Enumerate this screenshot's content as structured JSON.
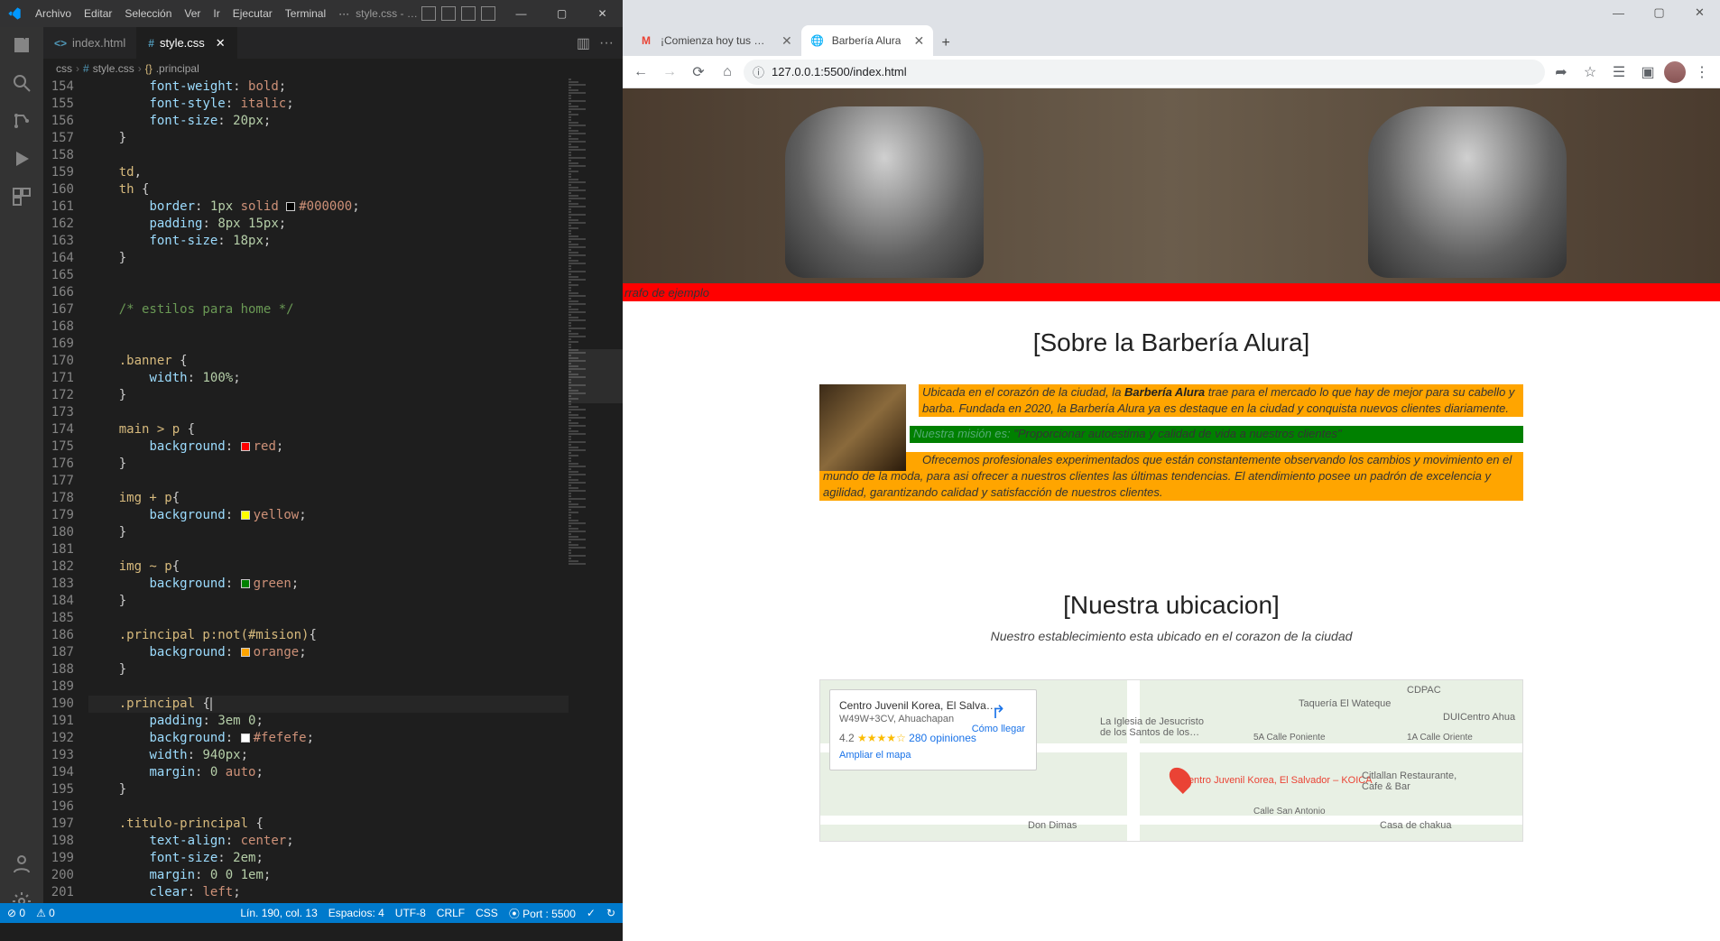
{
  "vscode": {
    "title": "style.css - HTML Y CSS - Visual Studi...",
    "menu": [
      "Archivo",
      "Editar",
      "Selección",
      "Ver",
      "Ir",
      "Ejecutar",
      "Terminal"
    ],
    "menu_dots": "···",
    "tabs": [
      {
        "icon": "#",
        "label": "index.html",
        "active": false
      },
      {
        "icon": "#",
        "label": "style.css",
        "active": true
      }
    ],
    "breadcrumb": {
      "root": "css",
      "file": "style.css",
      "sel": ".principal"
    },
    "status": {
      "errors": "⊘ 0",
      "warnings": "⚠ 0",
      "line_col": "Lín. 190, col. 13",
      "spaces": "Espacios: 4",
      "encoding": "UTF-8",
      "eol": "CRLF",
      "lang": "CSS",
      "port": "⦿ Port : 5500",
      "check": "✓",
      "sync": "↻"
    },
    "code": [
      {
        "n": 154,
        "html": "        <span class='tok-prop'>font-weight</span><span class='tok-punc'>:</span> <span class='tok-val'>bold</span><span class='tok-punc'>;</span>"
      },
      {
        "n": 155,
        "html": "        <span class='tok-prop'>font-style</span><span class='tok-punc'>:</span> <span class='tok-val'>italic</span><span class='tok-punc'>;</span>"
      },
      {
        "n": 156,
        "html": "        <span class='tok-prop'>font-size</span><span class='tok-punc'>:</span> <span class='tok-num'>20px</span><span class='tok-punc'>;</span>"
      },
      {
        "n": 157,
        "html": "    <span class='tok-punc'>}</span>"
      },
      {
        "n": 158,
        "html": ""
      },
      {
        "n": 159,
        "html": "    <span class='tok-sel'>td</span><span class='tok-punc'>,</span>"
      },
      {
        "n": 160,
        "html": "    <span class='tok-sel'>th</span> <span class='tok-punc'>{</span>"
      },
      {
        "n": 161,
        "html": "        <span class='tok-prop'>border</span><span class='tok-punc'>:</span> <span class='tok-num'>1px</span> <span class='tok-val'>solid</span> <span class='tok-swatch' style='background:#000'></span><span class='tok-val'>#000000</span><span class='tok-punc'>;</span>"
      },
      {
        "n": 162,
        "html": "        <span class='tok-prop'>padding</span><span class='tok-punc'>:</span> <span class='tok-num'>8px 15px</span><span class='tok-punc'>;</span>"
      },
      {
        "n": 163,
        "html": "        <span class='tok-prop'>font-size</span><span class='tok-punc'>:</span> <span class='tok-num'>18px</span><span class='tok-punc'>;</span>"
      },
      {
        "n": 164,
        "html": "    <span class='tok-punc'>}</span>"
      },
      {
        "n": 165,
        "html": ""
      },
      {
        "n": 166,
        "html": ""
      },
      {
        "n": 167,
        "html": "    <span class='tok-com'>/* estilos para home */</span>"
      },
      {
        "n": 168,
        "html": ""
      },
      {
        "n": 169,
        "html": ""
      },
      {
        "n": 170,
        "html": "    <span class='tok-sel'>.banner</span> <span class='tok-punc'>{</span>"
      },
      {
        "n": 171,
        "html": "        <span class='tok-prop'>width</span><span class='tok-punc'>:</span> <span class='tok-num'>100%</span><span class='tok-punc'>;</span>"
      },
      {
        "n": 172,
        "html": "    <span class='tok-punc'>}</span>"
      },
      {
        "n": 173,
        "html": ""
      },
      {
        "n": 174,
        "html": "    <span class='tok-sel'>main > p</span> <span class='tok-punc'>{</span>"
      },
      {
        "n": 175,
        "html": "        <span class='tok-prop'>background</span><span class='tok-punc'>:</span> <span class='tok-swatch' style='background:red'></span><span class='tok-val'>red</span><span class='tok-punc'>;</span>"
      },
      {
        "n": 176,
        "html": "    <span class='tok-punc'>}</span>"
      },
      {
        "n": 177,
        "html": ""
      },
      {
        "n": 178,
        "html": "    <span class='tok-sel'>img + p</span><span class='tok-punc'>{</span>"
      },
      {
        "n": 179,
        "html": "        <span class='tok-prop'>background</span><span class='tok-punc'>:</span> <span class='tok-swatch' style='background:yellow'></span><span class='tok-val'>yellow</span><span class='tok-punc'>;</span>"
      },
      {
        "n": 180,
        "html": "    <span class='tok-punc'>}</span>"
      },
      {
        "n": 181,
        "html": ""
      },
      {
        "n": 182,
        "html": "    <span class='tok-sel'>img ~ p</span><span class='tok-punc'>{</span>"
      },
      {
        "n": 183,
        "html": "        <span class='tok-prop'>background</span><span class='tok-punc'>:</span> <span class='tok-swatch' style='background:green'></span><span class='tok-val'>green</span><span class='tok-punc'>;</span>"
      },
      {
        "n": 184,
        "html": "    <span class='tok-punc'>}</span>"
      },
      {
        "n": 185,
        "html": ""
      },
      {
        "n": 186,
        "html": "    <span class='tok-sel'>.principal p:not(#mision)</span><span class='tok-punc'>{</span>"
      },
      {
        "n": 187,
        "html": "        <span class='tok-prop'>background</span><span class='tok-punc'>:</span> <span class='tok-swatch' style='background:orange'></span><span class='tok-val'>orange</span><span class='tok-punc'>;</span>"
      },
      {
        "n": 188,
        "html": "    <span class='tok-punc'>}</span>"
      },
      {
        "n": 189,
        "html": ""
      },
      {
        "n": 190,
        "html": "    <span class='tok-sel'>.principal</span> <span class='tok-punc'>{</span><span class='cursor-box'></span>",
        "current": true
      },
      {
        "n": 191,
        "html": "        <span class='tok-prop'>padding</span><span class='tok-punc'>:</span> <span class='tok-num'>3em 0</span><span class='tok-punc'>;</span>"
      },
      {
        "n": 192,
        "html": "        <span class='tok-prop'>background</span><span class='tok-punc'>:</span> <span class='tok-swatch' style='background:#fefefe'></span><span class='tok-val'>#fefefe</span><span class='tok-punc'>;</span>"
      },
      {
        "n": 193,
        "html": "        <span class='tok-prop'>width</span><span class='tok-punc'>:</span> <span class='tok-num'>940px</span><span class='tok-punc'>;</span>"
      },
      {
        "n": 194,
        "html": "        <span class='tok-prop'>margin</span><span class='tok-punc'>:</span> <span class='tok-num'>0</span> <span class='tok-val'>auto</span><span class='tok-punc'>;</span>"
      },
      {
        "n": 195,
        "html": "    <span class='tok-punc'>}</span>"
      },
      {
        "n": 196,
        "html": ""
      },
      {
        "n": 197,
        "html": "    <span class='tok-sel'>.titulo-principal</span> <span class='tok-punc'>{</span>"
      },
      {
        "n": 198,
        "html": "        <span class='tok-prop'>text-align</span><span class='tok-punc'>:</span> <span class='tok-val'>center</span><span class='tok-punc'>;</span>"
      },
      {
        "n": 199,
        "html": "        <span class='tok-prop'>font-size</span><span class='tok-punc'>:</span> <span class='tok-num'>2em</span><span class='tok-punc'>;</span>"
      },
      {
        "n": 200,
        "html": "        <span class='tok-prop'>margin</span><span class='tok-punc'>:</span> <span class='tok-num'>0 0 1em</span><span class='tok-punc'>;</span>"
      },
      {
        "n": 201,
        "html": "        <span class='tok-prop'>clear</span><span class='tok-punc'>:</span> <span class='tok-val'>left</span><span class='tok-punc'>;</span>"
      }
    ]
  },
  "chrome": {
    "tabs": [
      {
        "icon": "M",
        "label": "¡Comienza hoy tus estudios y no",
        "active": false,
        "color": "#ea4335"
      },
      {
        "icon": "🌐",
        "label": "Barbería Alura",
        "active": true,
        "color": "#888"
      }
    ],
    "url_proto": "ⓘ",
    "url": "127.0.0.1:5500/index.html",
    "page": {
      "red_text": "rrafo de ejemplo",
      "h2_about": "[Sobre la Barbería Alura]",
      "p1_a": "Ubicada en el corazón de la ciudad, la ",
      "p1_b": "Barbería Alura",
      "p1_c": " trae para el mercado lo que hay de mejor para su cabello y barba. Fundada en 2020, la Barbería Alura ya es destaque en la ciudad y conquista nuevos clientes diariamente.",
      "p2_a": "Nuestra misión es: ",
      "p2_b": "\"Proporcionar autoestima y calidad de vida a nuestros clientes\"",
      "p3": "Ofrecemos profesionales experimentados que están constantemente observando los cambios y movimiento en el mundo de la moda, para asi ofrecer a nuestros clientes las últimas tendencias. El atendimiento posee un padrón de excelencia y agilidad, garantizando calidad y satisfacción de nuestros clientes.",
      "h2_loc": "[Nuestra ubicacion]",
      "sub_loc": "Nuestro establecimiento esta ubicado en el corazon de la ciudad",
      "map": {
        "name": "Centro Juvenil Korea, El Salva…",
        "addr": "W49W+3CV, Ahuachapan",
        "rating": "4.2",
        "stars": "★★★★☆",
        "reviews": "280 opiniones",
        "expand": "Ampliar el mapa",
        "dir": "Cómo llegar",
        "marker": "Centro Juvenil Korea, El Salvador – KOICA",
        "l1": "Don Dimas",
        "l2": "Taquería El Wateque",
        "l3": "La Iglesia de Jesucristo de los Santos de los…",
        "l4": "Citlallan Restaurante, Cafe & Bar",
        "l5": "DUICentro Ahua",
        "l6": "CDPAC",
        "l7": "Casa de chakua",
        "l8": "5A Calle Poniente",
        "l9": "1A Calle Oriente",
        "l10": "Calle San Antonio"
      }
    }
  }
}
